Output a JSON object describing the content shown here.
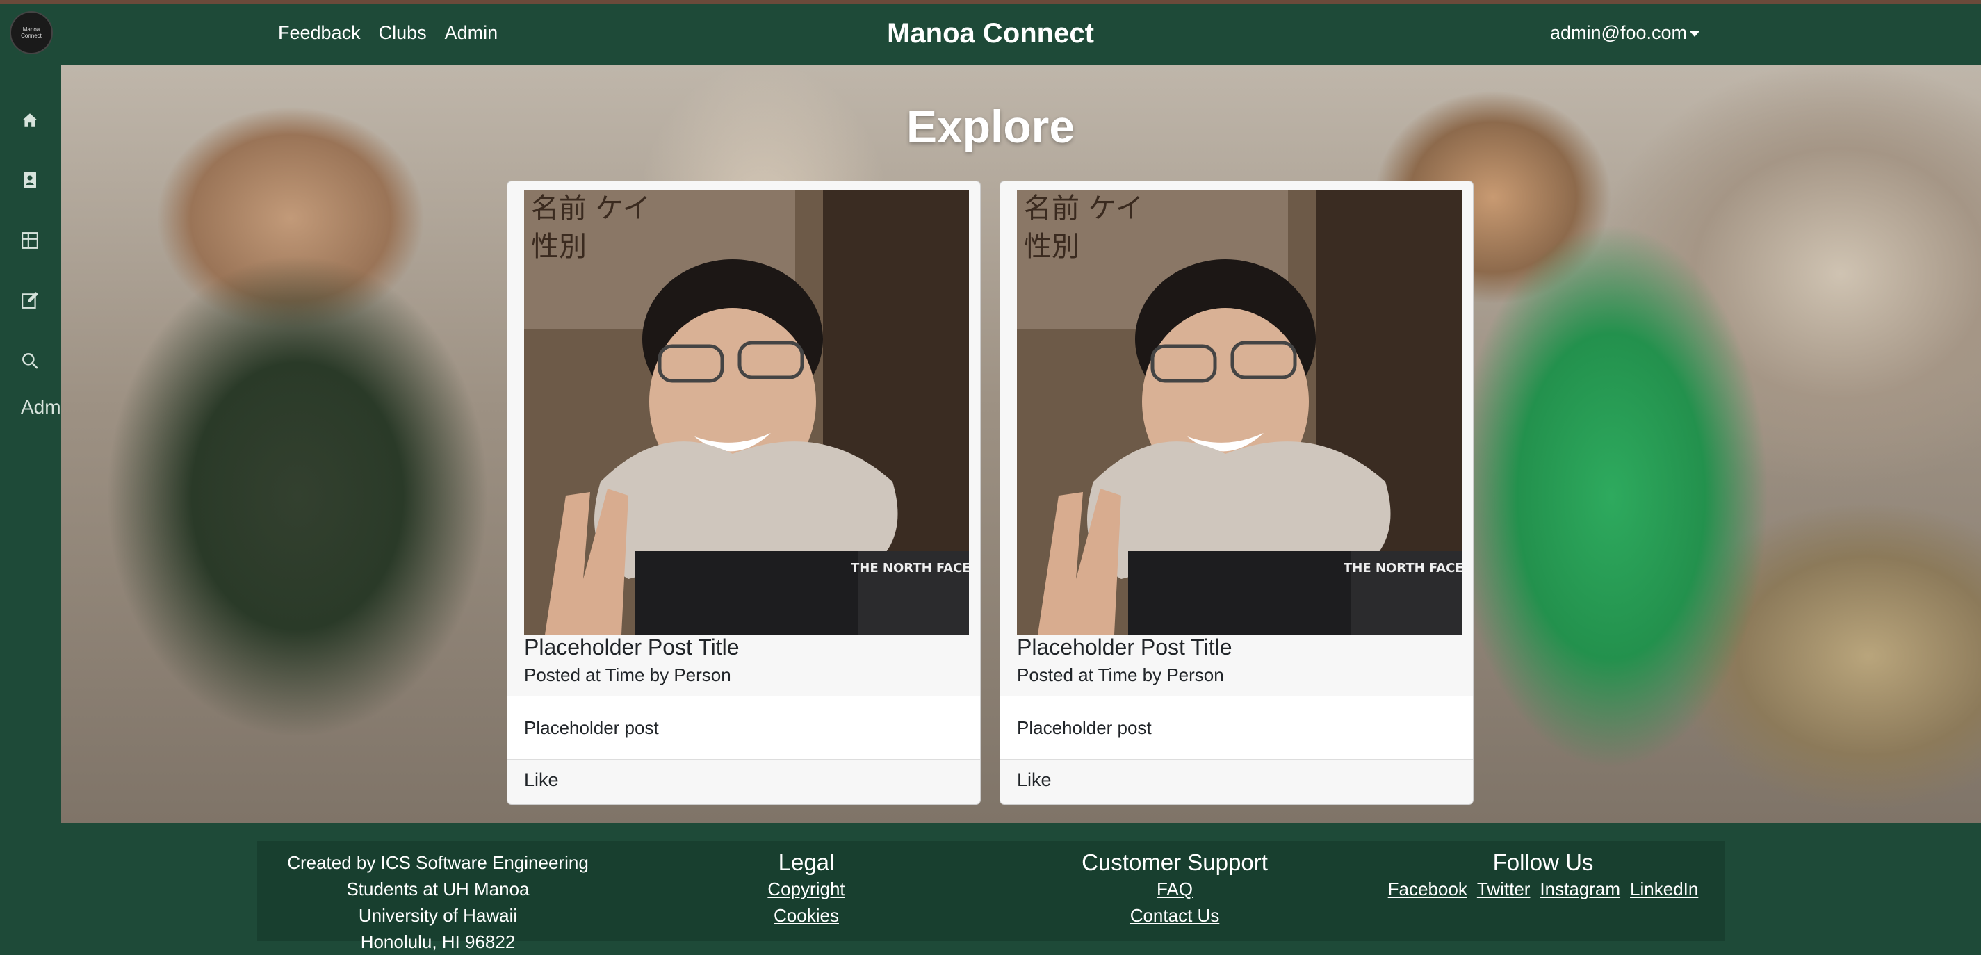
{
  "navbar": {
    "logo_text_line1": "Manoa",
    "logo_text_line2": "Connect",
    "links": [
      "Feedback",
      "Clubs",
      "Admin"
    ],
    "brand": "Manoa Connect",
    "user": "admin@foo.com"
  },
  "sidebar": {
    "icons": [
      "home-icon",
      "profile-card-icon",
      "grid-icon",
      "edit-icon",
      "search-icon"
    ],
    "label": "Admin"
  },
  "main": {
    "heading": "Explore",
    "posts": [
      {
        "title": "Placeholder Post Title",
        "meta": "Posted at Time by Person",
        "body": "Placeholder post",
        "like": "Like"
      },
      {
        "title": "Placeholder Post Title",
        "meta": "Posted at Time by Person",
        "body": "Placeholder post",
        "like": "Like"
      }
    ]
  },
  "footer": {
    "created_lines": [
      "Created by ICS Software Engineering",
      "Students at UH Manoa",
      "University of Hawaii",
      "Honolulu, HI 96822"
    ],
    "legal": {
      "heading": "Legal",
      "links": [
        "Copyright",
        "Cookies"
      ]
    },
    "support": {
      "heading": "Customer Support",
      "links": [
        "FAQ",
        "Contact Us"
      ]
    },
    "follow": {
      "heading": "Follow Us",
      "links": [
        "Facebook",
        "Twitter",
        "Instagram",
        "LinkedIn"
      ]
    }
  },
  "colors": {
    "primary": "#1e4a38",
    "footer": "#183f2f"
  }
}
